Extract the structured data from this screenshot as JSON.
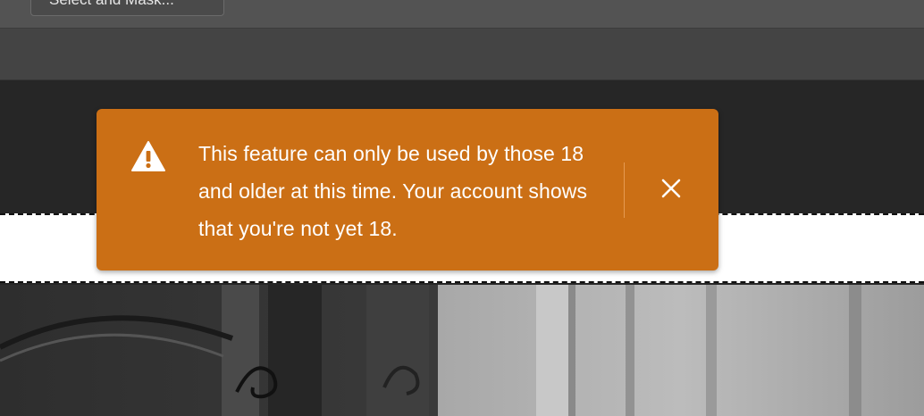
{
  "toolbar": {
    "select_and_mask_label": "Select and Mask..."
  },
  "toast": {
    "message": "This feature can only be used by those 18 and older at this time. Your account shows that you're not yet 18.",
    "icon": "warning-icon",
    "close_icon": "close-icon",
    "background_color": "#cb6f15"
  }
}
